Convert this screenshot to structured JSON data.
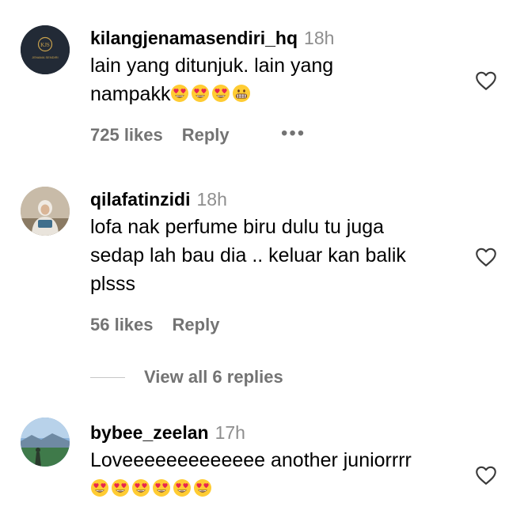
{
  "comments": [
    {
      "username": "kilangjenamasendiri_hq",
      "time": "18h",
      "text_line1": "lain yang ditunjuk. lain yang",
      "text_line2": "nampakk",
      "likes": "725 likes",
      "reply": "Reply",
      "more": "•••",
      "avatar_initials": "KJS",
      "avatar_caption": "JENAMA SENDIRI"
    },
    {
      "username": "qilafatinzidi",
      "time": "18h",
      "text_line1": "lofa nak perfume biru dulu tu juga",
      "text_line2": "sedap lah bau dia .. keluar kan balik",
      "text_line3": "plsss",
      "likes": "56 likes",
      "reply": "Reply"
    },
    {
      "username": "bybee_zeelan",
      "time": "17h",
      "text_line1": "Loveeeeeeeeeeeee another juniorrrr"
    }
  ],
  "view_replies": "View all 6 replies",
  "icons": {
    "heart": "heart-outline-icon",
    "heart_eyes": "heart-eyes-emoji",
    "grimace": "grimacing-face-emoji"
  },
  "colors": {
    "secondary_text": "#737373",
    "timestamp": "#8e8e8e",
    "emoji_face": "#FFCC33",
    "emoji_heart": "#E8264E"
  }
}
